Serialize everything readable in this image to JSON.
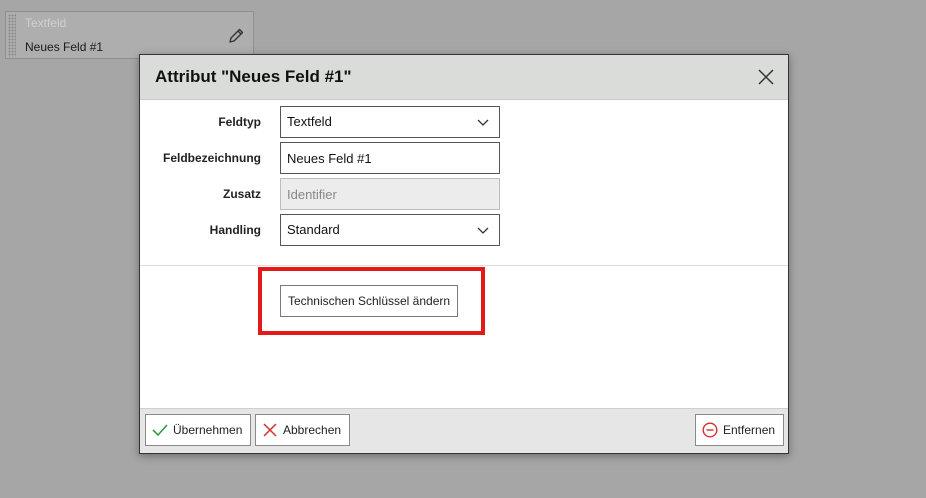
{
  "background_card": {
    "type_label": "Textfeld",
    "name_value": "Neues Feld #1"
  },
  "dialog": {
    "title": "Attribut \"Neues Feld #1\"",
    "fields": {
      "feldtyp": {
        "label": "Feldtyp",
        "value": "Textfeld"
      },
      "feldbezeichnung": {
        "label": "Feldbezeichnung",
        "value": "Neues Feld #1"
      },
      "zusatz": {
        "label": "Zusatz",
        "placeholder": "Identifier"
      },
      "handling": {
        "label": "Handling",
        "value": "Standard"
      }
    },
    "tech_key_button": "Technischen Schlüssel ändern",
    "footer": {
      "apply": "Übernehmen",
      "cancel": "Abbrechen",
      "remove": "Entfernen"
    }
  },
  "colors": {
    "highlight": "#e21a1a",
    "apply_icon": "#2e9e3e",
    "cancel_icon": "#d03030",
    "remove_icon": "#d03030"
  },
  "icons": [
    "pencil-icon",
    "close-icon",
    "chevron-down-icon",
    "check-icon",
    "x-icon",
    "minus-circle-icon"
  ]
}
